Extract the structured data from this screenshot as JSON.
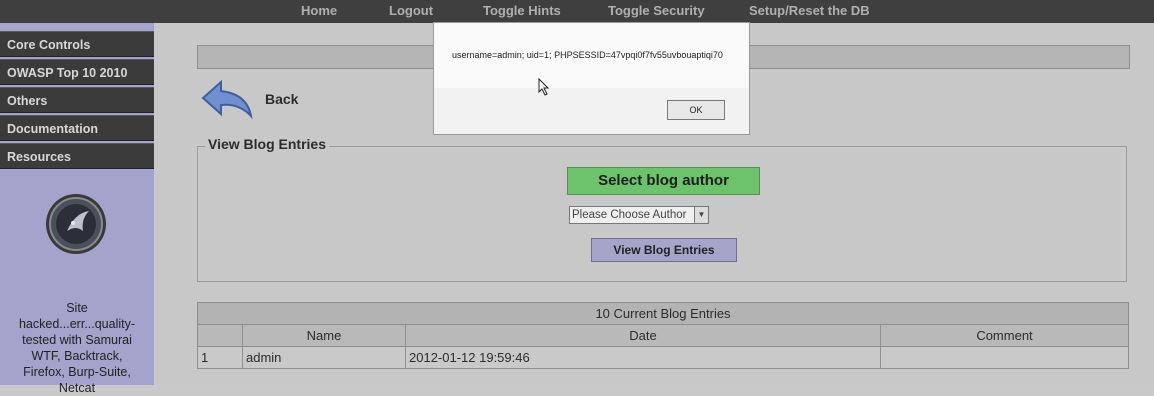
{
  "topnav": {
    "items": [
      "Home",
      "Logout",
      "Toggle Hints",
      "Toggle Security",
      "Setup/Reset the DB"
    ]
  },
  "sidebar": {
    "items": [
      "Core Controls",
      "OWASP Top 10 2010",
      "Others",
      "Documentation",
      "Resources"
    ],
    "footer_lines": [
      "Site",
      "hacked...err...quality-",
      "tested with Samurai",
      "WTF, Backtrack,",
      "Firefox, Burp-Suite,",
      "Netcat"
    ]
  },
  "main": {
    "back_label": "Back",
    "legend": "View Blog Entries",
    "select_author_label": "Select blog author",
    "author_select_value": "Please Choose Author",
    "view_button_label": "View Blog Entries"
  },
  "table": {
    "caption": "10 Current Blog Entries",
    "headers": [
      "",
      "Name",
      "Date",
      "Comment"
    ],
    "rows": [
      [
        "1",
        "admin",
        "2012-01-12 19:59:46",
        ""
      ]
    ]
  },
  "dialog": {
    "message": "username=admin; uid=1; PHPSESSID=47vpqi0f7fv55uvbouaptiqi70",
    "ok_label": "OK"
  },
  "colors": {
    "topbar": "#3f3f3f",
    "sidebar": "#a3a3cc",
    "select_author_bg": "#6cc36c",
    "view_button_bg": "#a5a5c9"
  }
}
